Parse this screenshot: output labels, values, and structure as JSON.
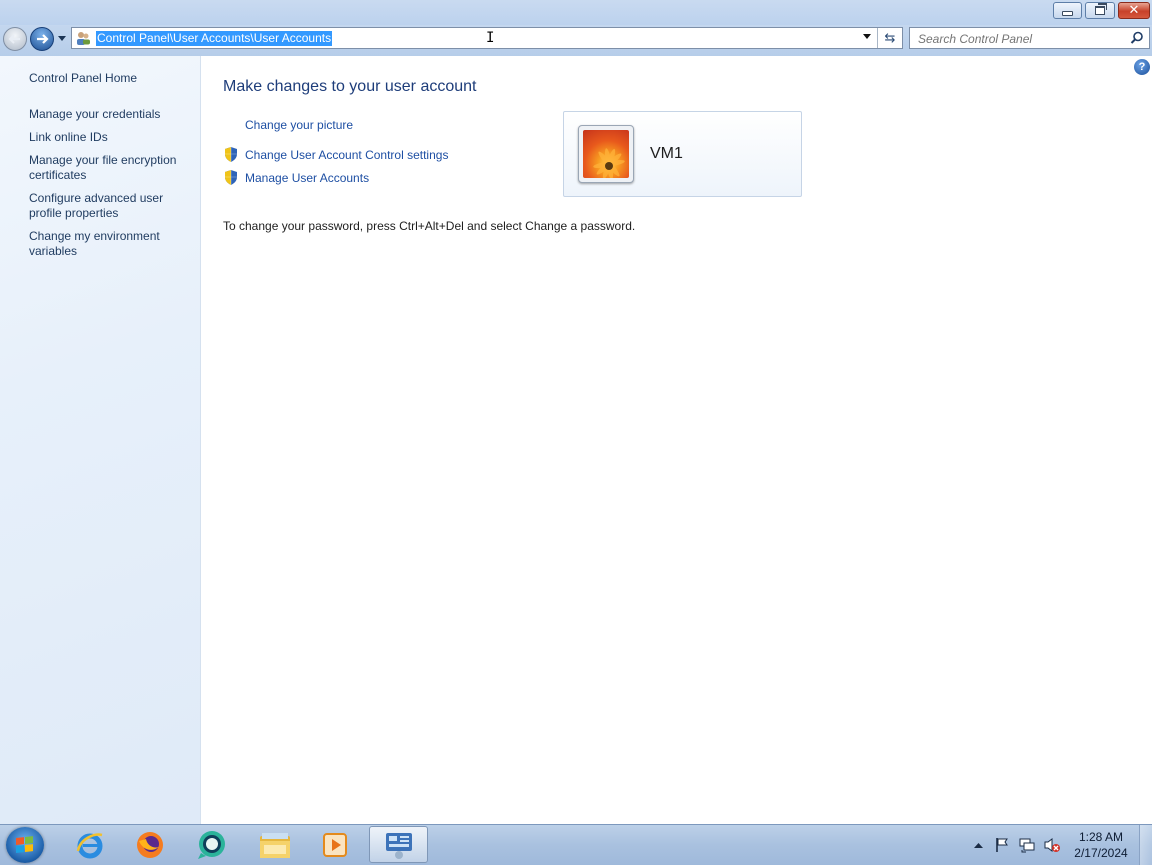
{
  "window": {
    "minimize_icon": "minimize-icon",
    "maximize_icon": "restore-icon",
    "close_icon": "close-icon"
  },
  "navigation": {
    "back_icon": "back-arrow-icon",
    "forward_icon": "forward-arrow-icon",
    "address_value": "Control Panel\\User Accounts\\User Accounts",
    "address_icon": "user-accounts-icon",
    "refresh_icon": "refresh-icon",
    "search_placeholder": "Search Control Panel",
    "search_icon": "search-icon"
  },
  "sidebar": {
    "home": "Control Panel Home",
    "items": [
      {
        "label": "Manage your credentials"
      },
      {
        "label": "Link online IDs"
      },
      {
        "label": "Manage your file encryption certificates"
      },
      {
        "label": "Configure advanced user profile properties"
      },
      {
        "label": "Change my environment variables"
      }
    ]
  },
  "main": {
    "title": "Make changes to your user account",
    "tasks": [
      {
        "label": "Change your picture",
        "icon": "none"
      },
      {
        "label": "Change User Account Control settings",
        "icon": "shield-icon"
      },
      {
        "label": "Manage User Accounts",
        "icon": "shield-icon"
      }
    ],
    "account_name": "VM1",
    "password_note": "To change your password, press Ctrl+Alt+Del and select Change a password.",
    "help_label": "?"
  },
  "taskbar": {
    "apps": [
      {
        "name": "internet-explorer-icon"
      },
      {
        "name": "firefox-icon"
      },
      {
        "name": "chat-app-icon"
      },
      {
        "name": "file-explorer-icon"
      },
      {
        "name": "media-player-icon"
      },
      {
        "name": "control-panel-icon",
        "active": true
      }
    ],
    "time": "1:28 AM",
    "date": "2/17/2024"
  },
  "colors": {
    "link": "#1e4fa3",
    "title": "#1e3d7a",
    "selection": "#3399ff",
    "close_button": "#c7412a"
  }
}
